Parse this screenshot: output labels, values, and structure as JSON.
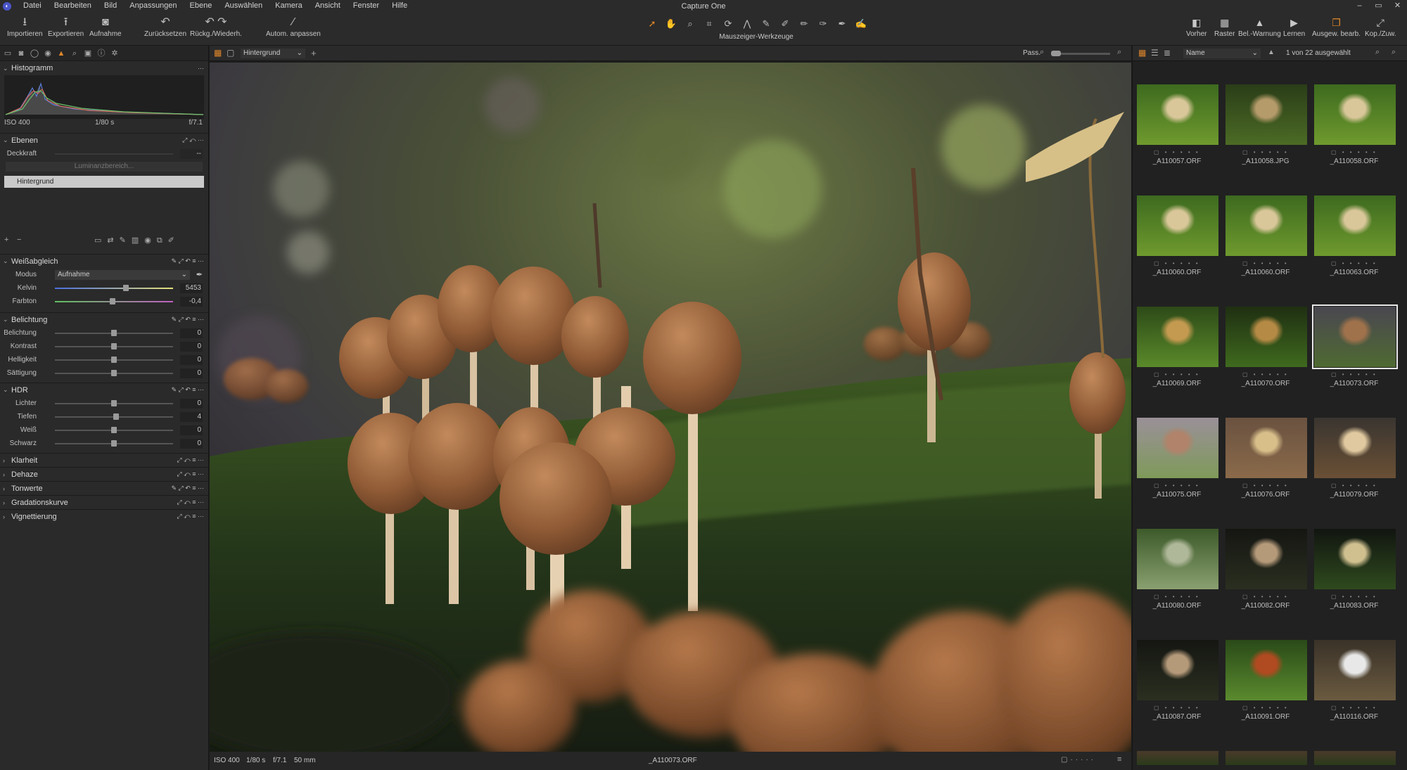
{
  "app": {
    "title": "Capture One"
  },
  "menu": [
    "Datei",
    "Bearbeiten",
    "Bild",
    "Anpassungen",
    "Ebene",
    "Auswählen",
    "Kamera",
    "Ansicht",
    "Fenster",
    "Hilfe"
  ],
  "window_controls": [
    "–",
    "▭",
    "✕"
  ],
  "toolbar": {
    "left": [
      {
        "label": "Importieren",
        "icon": "download-icon"
      },
      {
        "label": "Exportieren",
        "icon": "upload-icon"
      },
      {
        "label": "Aufnahme",
        "icon": "camera-icon"
      },
      {
        "label": "Zurücksetzen",
        "icon": "reset-icon"
      },
      {
        "label": "Rückg./Wiederh.",
        "icon": "undo-redo-icon"
      },
      {
        "label": "Autom. anpassen",
        "icon": "magic-wand-icon"
      }
    ],
    "cursor_tools_label": "Mauszeiger-Werkzeuge",
    "right": [
      {
        "label": "Vorher",
        "icon": "before-after-icon"
      },
      {
        "label": "Raster",
        "icon": "grid-icon"
      },
      {
        "label": "Bel.-Warnung",
        "icon": "warning-icon"
      },
      {
        "label": "Lernen",
        "icon": "learn-icon"
      },
      {
        "label": "Ausgew. bearb.",
        "icon": "edit-selected-icon"
      },
      {
        "label": "Kop./Zuw.",
        "icon": "copy-apply-icon"
      }
    ]
  },
  "histogram": {
    "title": "Histogramm",
    "iso": "ISO 400",
    "shutter": "1/80 s",
    "aperture": "f/7.1"
  },
  "layers": {
    "title": "Ebenen",
    "opacity_label": "Deckkraft",
    "opacity_value": "--",
    "luma_range": "Luminanzbereich...",
    "active_layer": "Hintergrund"
  },
  "white_balance": {
    "title": "Weißabgleich",
    "mode_label": "Modus",
    "mode_value": "Aufnahme",
    "sliders": [
      {
        "label": "Kelvin",
        "value": "5453",
        "pos": 0.6
      },
      {
        "label": "Farbton",
        "value": "-0,4",
        "pos": 0.49
      }
    ]
  },
  "exposure": {
    "title": "Belichtung",
    "sliders": [
      {
        "label": "Belichtung",
        "value": "0",
        "pos": 0.5
      },
      {
        "label": "Kontrast",
        "value": "0",
        "pos": 0.5
      },
      {
        "label": "Helligkeit",
        "value": "0",
        "pos": 0.5
      },
      {
        "label": "Sättigung",
        "value": "0",
        "pos": 0.5
      }
    ]
  },
  "hdr": {
    "title": "HDR",
    "sliders": [
      {
        "label": "Lichter",
        "value": "0",
        "pos": 0.5
      },
      {
        "label": "Tiefen",
        "value": "4",
        "pos": 0.52
      },
      {
        "label": "Weiß",
        "value": "0",
        "pos": 0.5
      },
      {
        "label": "Schwarz",
        "value": "0",
        "pos": 0.5
      }
    ]
  },
  "collapsed_tools": [
    "Klarheit",
    "Dehaze",
    "Tonwerte",
    "Gradationskurve",
    "Vignettierung"
  ],
  "viewer": {
    "layer_select": "Hintergrund",
    "zoom_label": "Pass.",
    "status": {
      "iso": "ISO 400",
      "shutter": "1/80 s",
      "aperture": "f/7.1",
      "focal": "50 mm",
      "filename": "_A110073.ORF"
    }
  },
  "browser": {
    "sort": "Name",
    "count": "1 von 22 ausgewählt",
    "thumbs": [
      {
        "name": "_A110057.ORF",
        "scene": "moss"
      },
      {
        "name": "_A110058.JPG",
        "scene": "moss-dark"
      },
      {
        "name": "_A110058.ORF",
        "scene": "moss"
      },
      {
        "name": "_A110060.ORF",
        "scene": "moss"
      },
      {
        "name": "_A110060.ORF",
        "scene": "moss"
      },
      {
        "name": "_A110063.ORF",
        "scene": "moss"
      },
      {
        "name": "_A110069.ORF",
        "scene": "green"
      },
      {
        "name": "_A110070.ORF",
        "scene": "green-dark"
      },
      {
        "name": "_A110073.ORF",
        "scene": "selected",
        "selected": true
      },
      {
        "name": "_A110075.ORF",
        "scene": "pale"
      },
      {
        "name": "_A110076.ORF",
        "scene": "bark"
      },
      {
        "name": "_A110079.ORF",
        "scene": "cluster"
      },
      {
        "name": "_A110080.ORF",
        "scene": "forest"
      },
      {
        "name": "_A110082.ORF",
        "scene": "night"
      },
      {
        "name": "_A110083.ORF",
        "scene": "night-green"
      },
      {
        "name": "_A110087.ORF",
        "scene": "night"
      },
      {
        "name": "_A110091.ORF",
        "scene": "leaf"
      },
      {
        "name": "_A110116.ORF",
        "scene": "white"
      }
    ]
  },
  "colors": {
    "accent": "#e0872b",
    "panel": "#2a2a2a",
    "background": "#1d1d1d"
  }
}
